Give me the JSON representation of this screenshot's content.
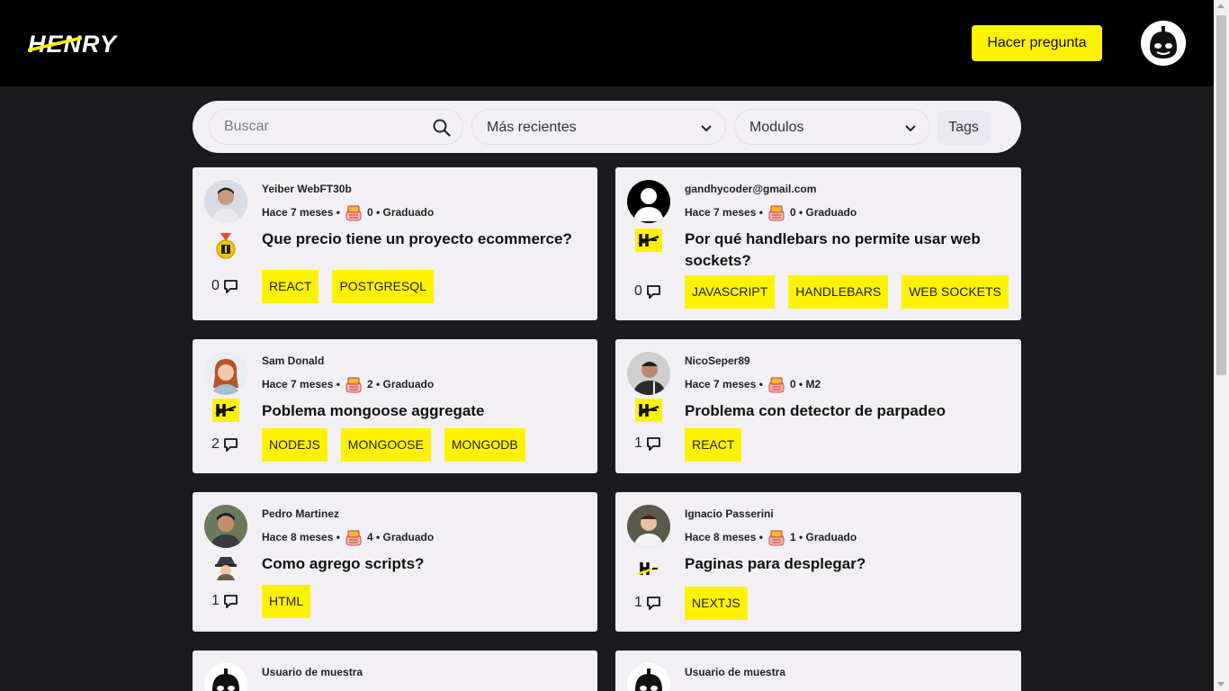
{
  "header": {
    "logo_text": "HENRY",
    "ask_button": "Hacer pregunta"
  },
  "filters": {
    "search_placeholder": "Buscar",
    "sort_selected": "Más recientes",
    "module_selected": "Modulos",
    "tags_button": "Tags"
  },
  "colors": {
    "accent": "#fff200",
    "header_bg": "#000000",
    "page_bg": "#1b1b1e",
    "card_bg": "#f2f0f4"
  },
  "cards": [
    {
      "user": "Yeiber WebFT30b",
      "time": "Hace 7 meses •",
      "points": "0 • Graduado",
      "title": "Que precio tiene un proyecto ecommerce?",
      "comments": "0",
      "tags": [
        "REACT",
        "POSTGRESQL"
      ],
      "badge": "medal-icon"
    },
    {
      "user": "gandhycoder@gmail.com",
      "time": "Hace 7 meses •",
      "points": "0 • Graduado",
      "title": "Por qué handlebars no permite usar web sockets?",
      "comments": "0",
      "tags": [
        "JAVASCRIPT",
        "HANDLEBARS",
        "WEB SOCKETS"
      ],
      "badge": "henry-badge-icon"
    },
    {
      "user": "Sam Donald",
      "time": "Hace 7 meses •",
      "points": "2 • Graduado",
      "title": "Poblema mongoose aggregate",
      "comments": "2",
      "tags": [
        "NODEJS",
        "MONGOOSE",
        "MONGODB"
      ],
      "badge": "henry-badge-icon"
    },
    {
      "user": "NicoSeper89",
      "time": "Hace 7 meses •",
      "points": "0 • M2",
      "title": "Problema con detector de parpadeo",
      "comments": "1",
      "tags": [
        "REACT"
      ],
      "badge": "henry-badge-icon"
    },
    {
      "user": "Pedro Martinez",
      "time": "Hace 8 meses •",
      "points": "4 • Graduado",
      "title": "Como agrego scripts?",
      "comments": "1",
      "tags": [
        "HTML"
      ],
      "badge": "detective-icon"
    },
    {
      "user": "Ignacio Passerini",
      "time": "Hace 8 meses •",
      "points": "1 • Graduado",
      "title": "Paginas para desplegar?",
      "comments": "1",
      "tags": [
        "NEXTJS"
      ],
      "badge": "henry-small-icon"
    },
    {
      "user": "Usuario de muestra"
    },
    {
      "user": "Usuario de muestra"
    }
  ]
}
